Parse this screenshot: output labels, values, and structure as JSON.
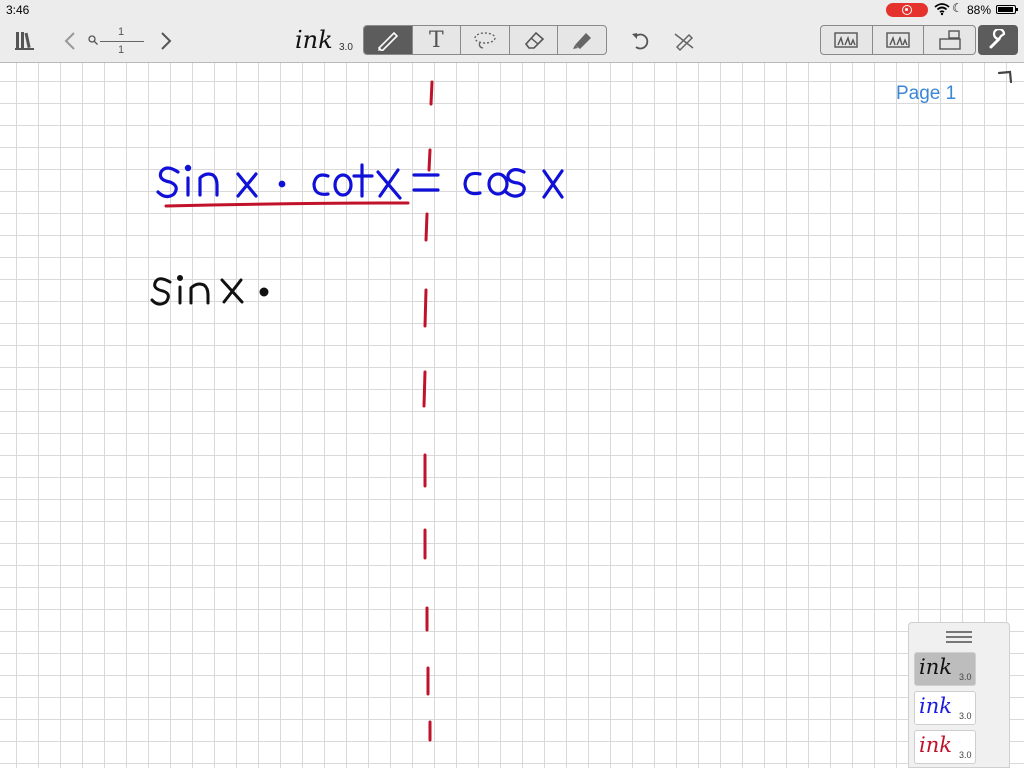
{
  "status_bar": {
    "time": "3:46",
    "battery_text": "88%",
    "recording_color": "#e5322d"
  },
  "toolbar": {
    "library_icon": "library-icon",
    "page_current": "1",
    "page_total": "1",
    "logo_text": "ink",
    "logo_version": "3.0",
    "tools": [
      {
        "name": "pen-tool",
        "icon": "pen-icon",
        "active": true
      },
      {
        "name": "text-tool",
        "icon": "text-icon",
        "label": "T",
        "active": false
      },
      {
        "name": "lasso-tool",
        "icon": "lasso-icon",
        "active": false
      },
      {
        "name": "eraser-tool",
        "icon": "eraser-icon",
        "active": false
      },
      {
        "name": "highlighter-tool",
        "icon": "highlighter-icon",
        "active": false
      }
    ],
    "undo_icon": "undo-icon",
    "hide-ink_icon": "hide-ink-icon",
    "view_icons": [
      "two-page-icon",
      "thumbnail-icon",
      "present-icon"
    ],
    "settings_icon": "wrench-icon"
  },
  "canvas": {
    "page_label": "Page 1",
    "grid_color": "#d9d9d9",
    "ink_blue_text": "sin x · cot x = cos x",
    "ink_black_text": "sin x ·",
    "ink_colors": {
      "blue": "#1010d8",
      "black": "#111111",
      "red": "#c0122a"
    }
  },
  "palette": {
    "pens": [
      {
        "label": "ink",
        "version": "3.0",
        "color": "#111111",
        "selected": true
      },
      {
        "label": "ink",
        "version": "3.0",
        "color": "#1a1ae0",
        "selected": false
      },
      {
        "label": "ink",
        "version": "3.0",
        "color": "#c0122a",
        "selected": false
      }
    ]
  }
}
